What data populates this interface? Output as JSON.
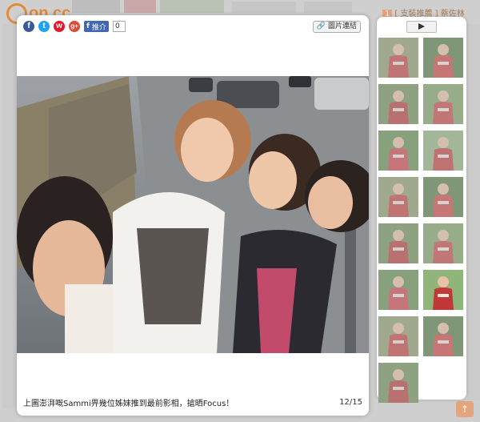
{
  "background": {
    "logo_text": "on.cc",
    "top_right_badge": "1",
    "top_right_text": "[ 支裝推薦 ] 蔡佐林"
  },
  "lightbox": {
    "share_icons": [
      "facebook-icon",
      "twitter-icon",
      "weibo-icon",
      "google-plus-icon"
    ],
    "share_glyphs": [
      "f",
      "t",
      "w",
      "g+"
    ],
    "share_colors": [
      "#3b5998",
      "#1da1f2",
      "#e6162d",
      "#dd4b39"
    ],
    "fb_like_label": "推介",
    "fb_like_count": "0",
    "link_button": "圖片連結",
    "caption": "上圖澎湃嘅Sammi畀幾位姊妹推到最前影相，搶晒Focus！",
    "counter": "12/15"
  },
  "thumbnails": {
    "count": 15,
    "selected_index": 11
  },
  "colors": {
    "accent_orange": "#e08a3c",
    "fb_blue": "#4267b2"
  }
}
